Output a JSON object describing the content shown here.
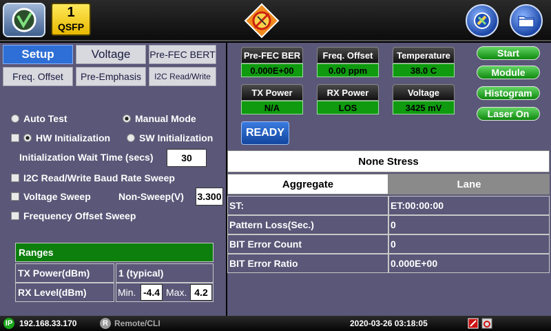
{
  "header": {
    "port_number": "1",
    "port_type": "QSFP"
  },
  "left": {
    "tabs": [
      "Setup",
      "Voltage",
      "Pre-FEC BERT",
      "Freq. Offset",
      "Pre-Emphasis",
      "I2C Read/Write"
    ],
    "mode_auto": "Auto Test",
    "mode_manual": "Manual Mode",
    "hw_init": "HW Initialization",
    "sw_init": "SW Initialization",
    "init_wait_label": "Initialization Wait Time (secs)",
    "init_wait_value": "30",
    "i2c_sweep": "I2C Read/Write Baud Rate Sweep",
    "voltage_sweep": "Voltage Sweep",
    "non_sweep_label": "Non-Sweep(V)",
    "non_sweep_value": "3.300",
    "freq_sweep": "Frequency Offset Sweep",
    "ranges": {
      "title": "Ranges",
      "tx_label": "TX Power(dBm)",
      "tx_value": "1 (typical)",
      "rx_label": "RX Level(dBm)",
      "min_label": "Min.",
      "min_value": "-4.4",
      "max_label": "Max.",
      "max_value": "4.2"
    }
  },
  "right": {
    "meters": [
      {
        "label": "Pre-FEC BER",
        "value": "0.000E+00"
      },
      {
        "label": "Freq. Offset",
        "value": "0.00 ppm"
      },
      {
        "label": "Temperature",
        "value": "38.0 C"
      },
      {
        "label": "TX Power",
        "value": "N/A"
      },
      {
        "label": "RX Power",
        "value": "LOS"
      },
      {
        "label": "Voltage",
        "value": "3425 mV"
      }
    ],
    "buttons": [
      "Start",
      "Module",
      "Histogram",
      "Laser On"
    ],
    "ready": "READY",
    "stress": "None Stress",
    "subtabs": [
      "Aggregate",
      "Lane"
    ],
    "results": [
      {
        "label": "ST:",
        "value": "ET:00:00:00"
      },
      {
        "label": "Pattern Loss(Sec.)",
        "value": "0"
      },
      {
        "label": "BIT Error Count",
        "value": "0"
      },
      {
        "label": "BIT Error Ratio",
        "value": "0.000E+00"
      }
    ]
  },
  "status": {
    "ip_badge": "IP",
    "ip": "192.168.33.170",
    "remote_badge": "R",
    "remote": "Remote/CLI",
    "datetime": "2020-03-26  03:18:05"
  },
  "colors": {
    "panel": "#5a5778",
    "meter_value": "#0f9a0f",
    "accent_blue": "#2d6fd6",
    "ranges_header": "#0d7f0d"
  }
}
